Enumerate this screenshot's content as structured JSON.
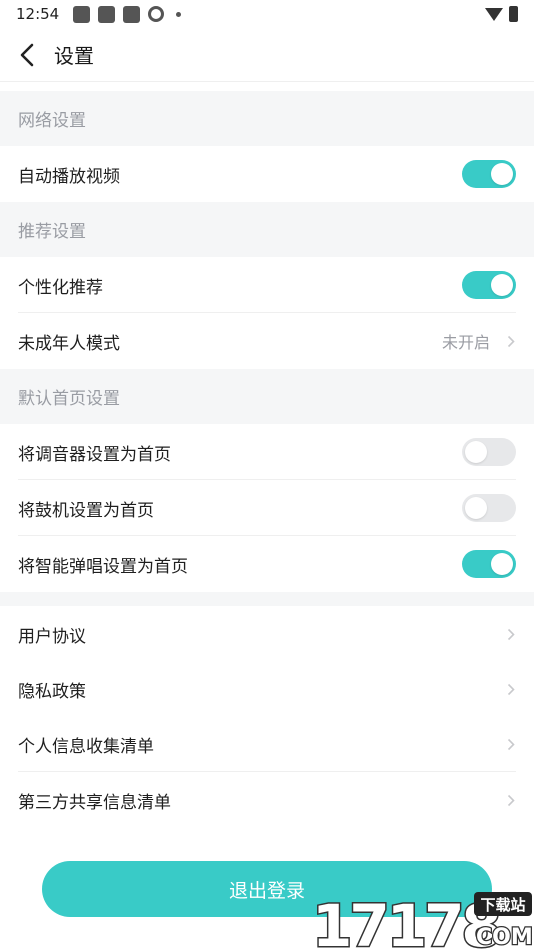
{
  "status_bar": {
    "time": "12:54"
  },
  "header": {
    "title": "设置"
  },
  "sections": {
    "network": {
      "title": "网络设置",
      "items": [
        {
          "label": "自动播放视频",
          "toggle": true
        }
      ]
    },
    "recommend": {
      "title": "推荐设置",
      "items": [
        {
          "label": "个性化推荐",
          "toggle": true
        },
        {
          "label": "未成年人模式",
          "value": "未开启"
        }
      ]
    },
    "homepage": {
      "title": "默认首页设置",
      "items": [
        {
          "label": "将调音器设置为首页",
          "toggle": false
        },
        {
          "label": "将鼓机设置为首页",
          "toggle": false
        },
        {
          "label": "将智能弹唱设置为首页",
          "toggle": true
        }
      ]
    },
    "legal": {
      "items": [
        {
          "label": "用户协议"
        },
        {
          "label": "隐私政策"
        },
        {
          "label": "个人信息收集清单"
        },
        {
          "label": "第三方共享信息清单"
        }
      ]
    }
  },
  "logout": {
    "label": "退出登录"
  },
  "watermark": {
    "text": "17178",
    "badge": "下载站",
    "suffix": "COM"
  },
  "colors": {
    "accent": "#39cbc7",
    "section_bg": "#f5f6f7",
    "section_text": "#999ca3"
  }
}
